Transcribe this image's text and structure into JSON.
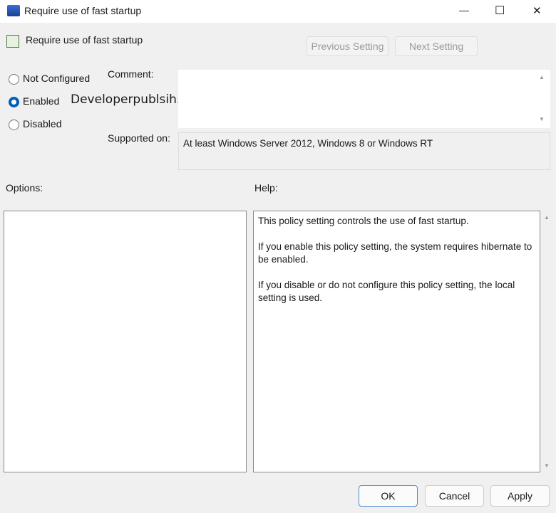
{
  "window": {
    "title": "Require use of fast startup",
    "minimize": "—",
    "maximize": "☐",
    "close": "✕"
  },
  "header": {
    "title": "Require use of fast startup",
    "previous": "Previous Setting",
    "next": "Next Setting"
  },
  "state": {
    "options": [
      "Not Configured",
      "Enabled",
      "Disabled"
    ],
    "selected": "Enabled"
  },
  "watermark": "Developerpublsih.com",
  "comment": {
    "label": "Comment:",
    "value": ""
  },
  "supported": {
    "label": "Supported on:",
    "value": "At least Windows Server 2012, Windows 8 or Windows RT"
  },
  "options_label": "Options:",
  "help": {
    "label": "Help:",
    "paragraphs": [
      "This policy setting controls the use of fast startup.",
      "If you enable this policy setting, the system requires hibernate to be enabled.",
      "If you disable or do not configure this policy setting, the local setting is used."
    ]
  },
  "buttons": {
    "ok": "OK",
    "cancel": "Cancel",
    "apply": "Apply"
  }
}
